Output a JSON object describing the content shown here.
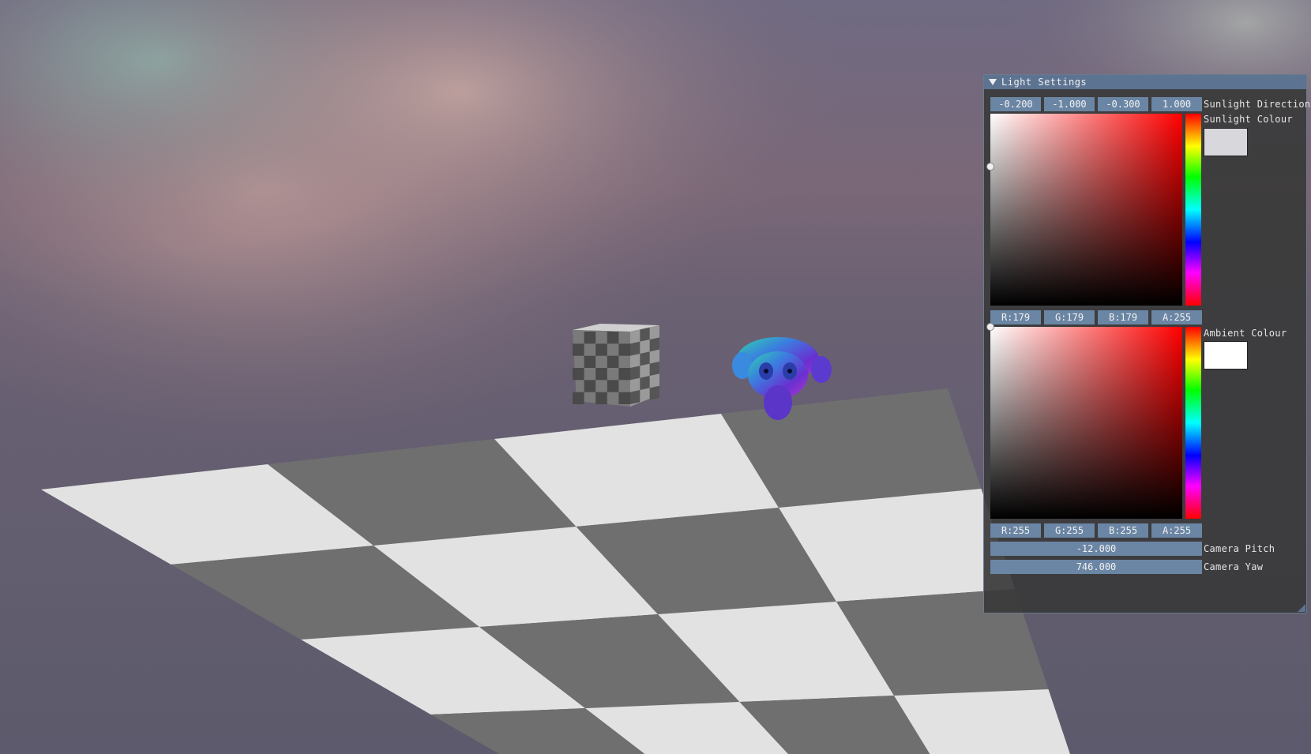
{
  "window": {
    "title": "Light Settings"
  },
  "sunlight_direction": {
    "values": [
      "-0.200",
      "-1.000",
      "-0.300",
      "1.000"
    ],
    "label": "Sunlight Direction"
  },
  "sunlight_colour": {
    "label": "Sunlight Colour",
    "swatch_color": "#d8d8dc",
    "channels": [
      "R:179",
      "G:179",
      "B:179",
      "A:255"
    ]
  },
  "ambient_colour": {
    "label": "Ambient Colour",
    "swatch_color": "#ffffff",
    "channels": [
      "R:255",
      "G:255",
      "B:255",
      "A:255"
    ]
  },
  "camera_pitch": {
    "value": "-12.000",
    "label": "Camera Pitch"
  },
  "camera_yaw": {
    "value": "746.000",
    "label": "Camera Yaw"
  },
  "colors": {
    "accent": "#5d7392",
    "field_bg": "#6b86a4",
    "panel_bg": "#3a3a3a"
  },
  "icons": [
    "collapse-arrow-icon",
    "resize-grip-icon"
  ]
}
